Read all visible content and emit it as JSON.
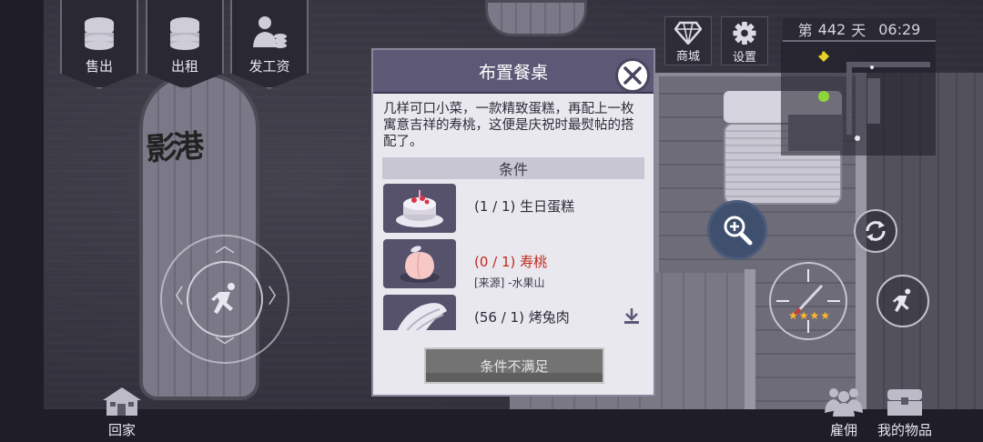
{
  "top_left_buttons": [
    {
      "label": "售出",
      "icon": "coin-stack-icon"
    },
    {
      "label": "出租",
      "icon": "coin-stack-icon"
    },
    {
      "label": "发工资",
      "icon": "pay-worker-icon"
    }
  ],
  "top_right": {
    "shop_label": "商城",
    "settings_label": "设置",
    "day_prefix": "第",
    "day_number": "442",
    "day_suffix": "天",
    "time": "06:29",
    "minimap_level": "3"
  },
  "map": {
    "sign_text": "影港"
  },
  "bottom": {
    "home_label": "回家",
    "hire_label": "雇佣",
    "items_label": "我的物品"
  },
  "controls": {
    "star_rating": 4,
    "star_glyphs": "★★★★"
  },
  "dialog": {
    "title": "布置餐桌",
    "description": "几样可口小菜，一款精致蛋糕，再配上一枚寓意吉祥的寿桃，这便是庆祝时最熨帖的搭配了。",
    "conditions_header": "条件",
    "items": [
      {
        "progress": "(1 / 1)",
        "name": "生日蛋糕",
        "met": true,
        "icon": "birthday-cake-icon"
      },
      {
        "progress": "(0 / 1)",
        "name": "寿桃",
        "met": false,
        "source": "[来源] -水果山",
        "icon": "longevity-peach-icon"
      },
      {
        "progress": "(56 / 1)",
        "name": "烤兔肉",
        "met": true,
        "icon": "roast-rabbit-icon"
      }
    ],
    "submit_label": "条件不满足"
  },
  "colors": {
    "dialog_header": "#5c5875",
    "unmet_text": "#c2281c",
    "zoom_button": "#3f4f6e"
  }
}
